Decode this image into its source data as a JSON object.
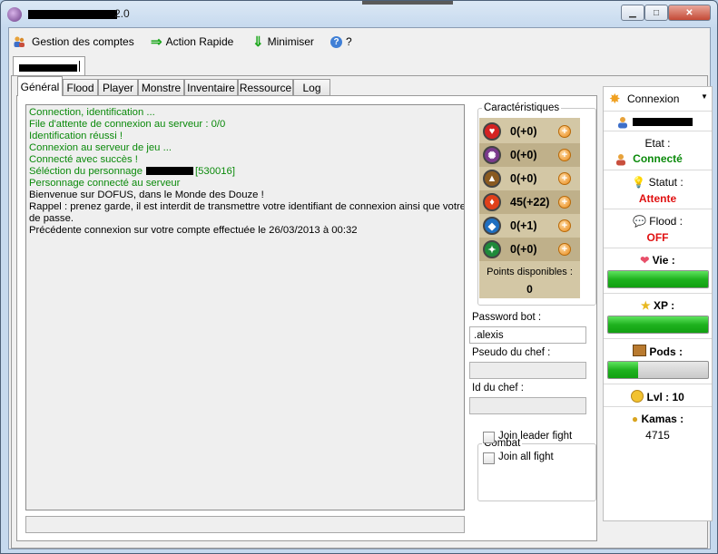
{
  "window": {
    "title_suffix": "2.0"
  },
  "menu": {
    "manage_accounts": "Gestion des comptes",
    "quick_action": "Action Rapide",
    "minimize": "Minimiser",
    "help": "?"
  },
  "tabs": [
    "Général",
    "Flood",
    "Player",
    "Monstre",
    "Inventaire",
    "Ressource",
    "Log"
  ],
  "log_lines": [
    {
      "text": "Connection, identification ...",
      "color": "green"
    },
    {
      "text": "File d'attente de connexion au serveur : 0/0",
      "color": "green"
    },
    {
      "text": "Identification réussi !",
      "color": "green"
    },
    {
      "text": "Connexion au serveur de jeu ...",
      "color": "green"
    },
    {
      "text": "Connecté avec succès !",
      "color": "green"
    },
    {
      "text": "Séléction du personnage",
      "suffix": "[530016]",
      "color": "green"
    },
    {
      "text": "Personnage connecté au serveur",
      "color": "green"
    },
    {
      "text": "Bienvenue sur DOFUS, dans le Monde des Douze !",
      "color": "black"
    },
    {
      "text": "Rappel : prenez garde, il est interdit de transmettre votre identifiant de connexion ainsi que votre mot",
      "color": "black"
    },
    {
      "text": "de passe.",
      "color": "black"
    },
    {
      "text": "Précédente connexion sur votre compte effectuée le 26/03/2013 à 00:32",
      "color": "black"
    }
  ],
  "characteristics": {
    "title": "Caractéristiques",
    "rows": [
      {
        "icon": "heart-icon",
        "value": "0(+0)",
        "color": "#d42222"
      },
      {
        "icon": "wisdom-icon",
        "value": "0(+0)",
        "color": "#7a3a8c"
      },
      {
        "icon": "strength-icon",
        "value": "0(+0)",
        "color": "#8a5a20"
      },
      {
        "icon": "intelligence-icon",
        "value": "45(+22)",
        "color": "#e0401a"
      },
      {
        "icon": "chance-icon",
        "value": "0(+1)",
        "color": "#1f6fc0"
      },
      {
        "icon": "agility-icon",
        "value": "0(+0)",
        "color": "#1f8a3a"
      }
    ],
    "points_label": "Points disponibles :",
    "points_value": "0"
  },
  "fields": {
    "password_label": "Password bot :",
    "password_value": ".alexis",
    "leader_pseudo_label": "Pseudo du chef :",
    "leader_pseudo_value": "",
    "leader_id_label": "Id du chef :",
    "leader_id_value": ""
  },
  "combat": {
    "title": "Combat",
    "join_leader": "Join leader fight",
    "join_all": "Join all fight"
  },
  "status_panel": {
    "connect_label": "Connexion",
    "etat_label": "Etat :",
    "etat_value": "Connecté",
    "statut_label": "Statut :",
    "statut_value": "Attente",
    "flood_label": "Flood :",
    "flood_value": "OFF",
    "life_label": "Vie :",
    "life_fraction": 1.0,
    "xp_label": "XP :",
    "xp_fraction": 1.0,
    "pods_label": "Pods :",
    "pods_fraction": 0.3,
    "lvl_label": "Lvl : 10",
    "kamas_label": "Kamas :",
    "kamas_value": "4715"
  },
  "colors": {
    "green": "#0b8a0b",
    "red": "#e01010",
    "bar_green": "#1fb21f"
  }
}
